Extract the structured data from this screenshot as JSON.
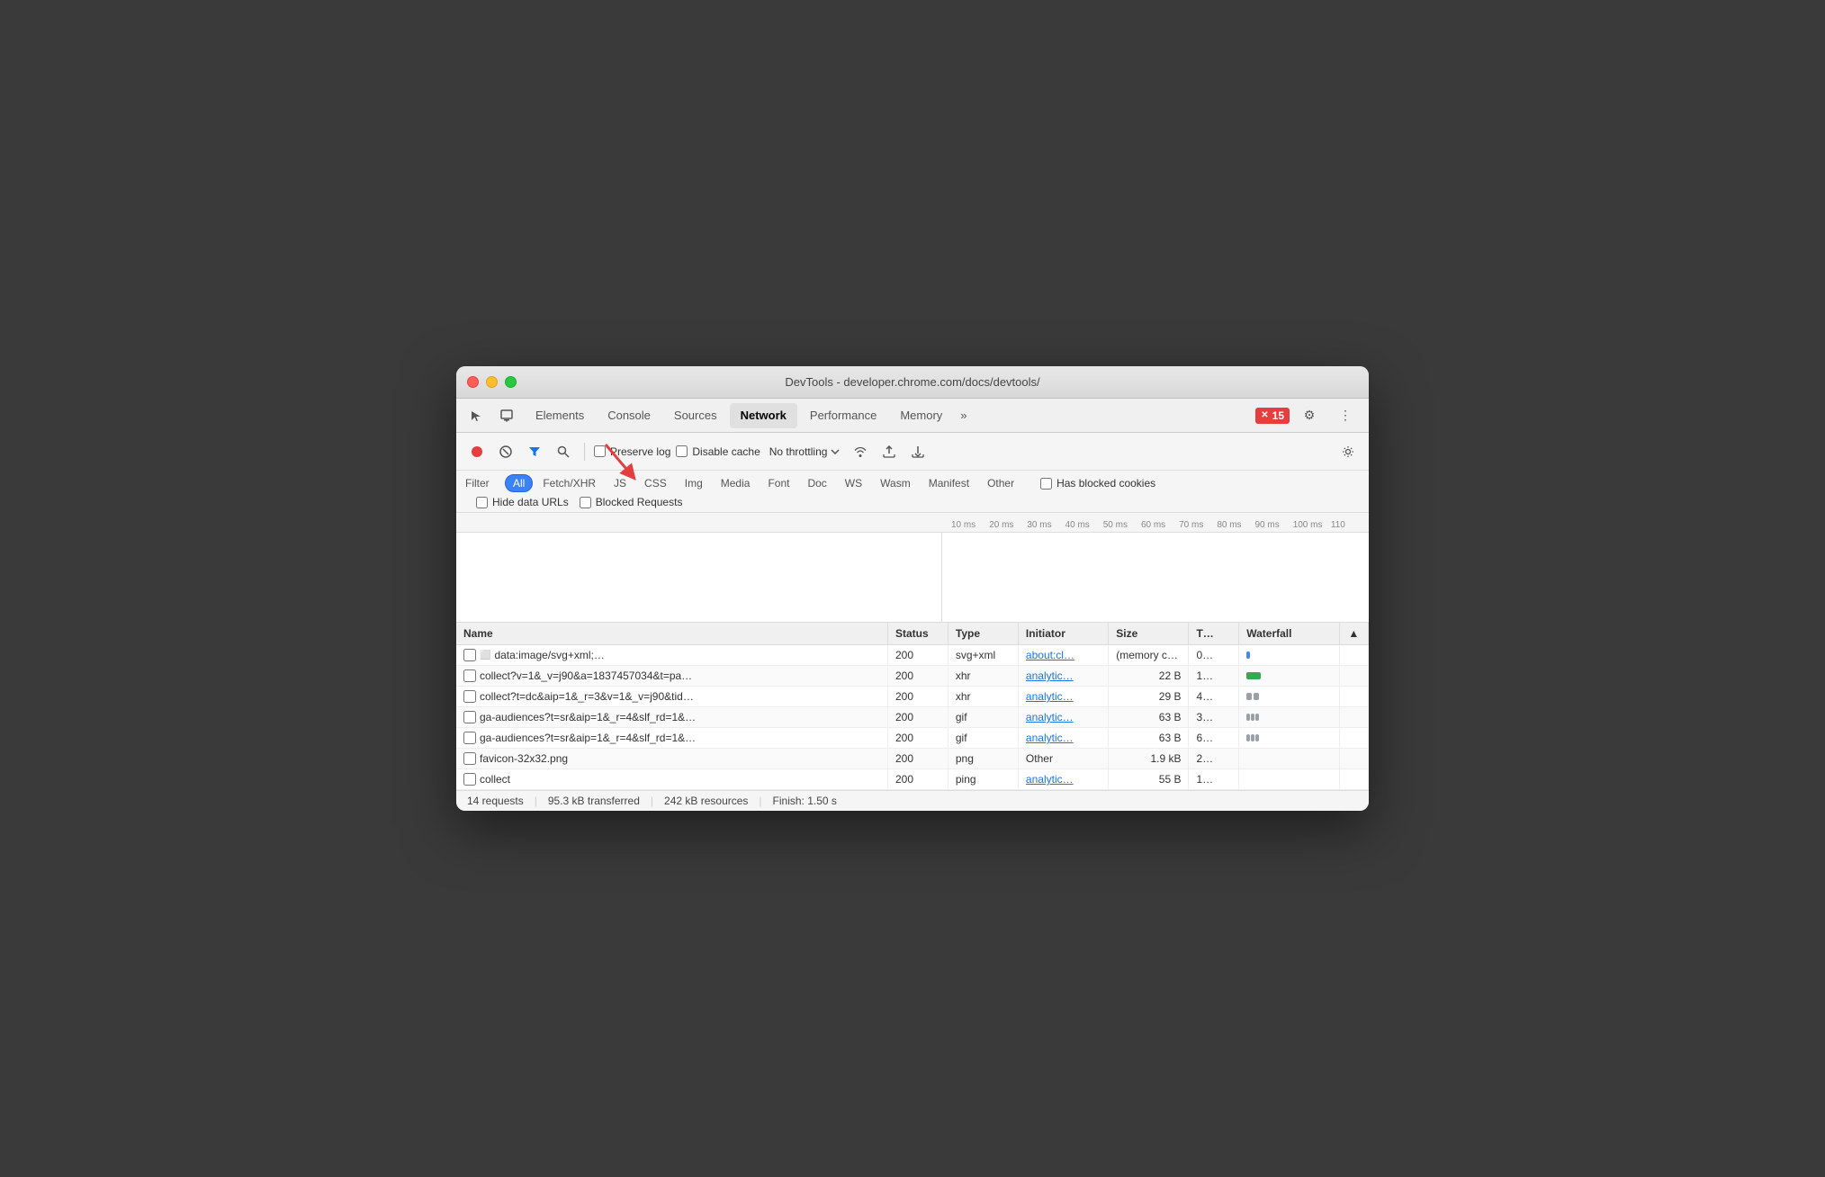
{
  "window": {
    "title": "DevTools - developer.chrome.com/docs/devtools/"
  },
  "tabs": {
    "items": [
      {
        "label": "Elements",
        "active": false
      },
      {
        "label": "Console",
        "active": false
      },
      {
        "label": "Sources",
        "active": false
      },
      {
        "label": "Network",
        "active": true
      },
      {
        "label": "Performance",
        "active": false
      },
      {
        "label": "Memory",
        "active": false
      }
    ],
    "more_label": "»",
    "error_count": "15",
    "settings_label": "⚙",
    "menu_label": "⋮"
  },
  "toolbar": {
    "record_title": "Record network log",
    "clear_title": "Clear",
    "filter_title": "Filter",
    "search_title": "Search",
    "preserve_log_label": "Preserve log",
    "disable_cache_label": "Disable cache",
    "throttle_label": "No throttling",
    "settings_title": "Network settings"
  },
  "filterbar": {
    "filter_label": "Filter",
    "hide_data_urls_label": "Hide data URLs",
    "types": [
      "All",
      "Fetch/XHR",
      "JS",
      "CSS",
      "Img",
      "Media",
      "Font",
      "Doc",
      "WS",
      "Wasm",
      "Manifest",
      "Other"
    ],
    "active_type": "All",
    "has_blocked_cookies_label": "Has blocked cookies",
    "blocked_requests_label": "Blocked Requests"
  },
  "timeline": {
    "marks": [
      "10 ms",
      "20 ms",
      "30 ms",
      "40 ms",
      "50 ms",
      "60 ms",
      "70 ms",
      "80 ms",
      "90 ms",
      "100 ms",
      "110"
    ]
  },
  "table": {
    "headers": [
      "Name",
      "Status",
      "Type",
      "Initiator",
      "Size",
      "T…",
      "Waterfall"
    ],
    "rows": [
      {
        "name": "data:image/svg+xml;…",
        "status": "200",
        "type": "svg+xml",
        "initiator": "about:cl…",
        "size": "(memory cache)",
        "time": "0…",
        "waterfall_color": "blue",
        "has_icon": true
      },
      {
        "name": "collect?v=1&_v=j90&a=1837457034&t=pa…",
        "status": "200",
        "type": "xhr",
        "initiator": "analytic…",
        "size": "22 B",
        "time": "1…",
        "waterfall_color": "green",
        "has_icon": false
      },
      {
        "name": "collect?t=dc&aip=1&_r=3&v=1&_v=j90&tid…",
        "status": "200",
        "type": "xhr",
        "initiator": "analytic…",
        "size": "29 B",
        "time": "4…",
        "waterfall_color": "gray2",
        "has_icon": false
      },
      {
        "name": "ga-audiences?t=sr&aip=1&_r=4&slf_rd=1&…",
        "status": "200",
        "type": "gif",
        "initiator": "analytic…",
        "size": "63 B",
        "time": "3…",
        "waterfall_color": "gray",
        "has_icon": false
      },
      {
        "name": "ga-audiences?t=sr&aip=1&_r=4&slf_rd=1&…",
        "status": "200",
        "type": "gif",
        "initiator": "analytic…",
        "size": "63 B",
        "time": "6…",
        "waterfall_color": "gray",
        "has_icon": false
      },
      {
        "name": "favicon-32x32.png",
        "status": "200",
        "type": "png",
        "initiator": "Other",
        "size": "1.9 kB",
        "time": "2…",
        "waterfall_color": "none",
        "has_icon": false
      },
      {
        "name": "collect",
        "status": "200",
        "type": "ping",
        "initiator": "analytic…",
        "size": "55 B",
        "time": "1…",
        "waterfall_color": "none",
        "has_icon": false
      }
    ]
  },
  "statusbar": {
    "requests": "14 requests",
    "transferred": "95.3 kB transferred",
    "resources": "242 kB resources",
    "finish": "Finish: 1.50 s"
  }
}
